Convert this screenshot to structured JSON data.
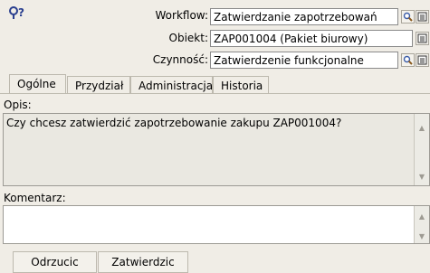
{
  "header": {
    "workflow_label": "Workflow:",
    "workflow_value": "Zatwierdzanie zapotrzebowań",
    "object_label": "Obiekt:",
    "object_value": "ZAP001004 (Pakiet biurowy)",
    "activity_label": "Czynność:",
    "activity_value": "Zatwierdzenie funkcjonalne"
  },
  "tabs": [
    {
      "label": "Ogólne"
    },
    {
      "label": "Przydział"
    },
    {
      "label": "Administracja"
    },
    {
      "label": "Historia"
    }
  ],
  "main": {
    "description_label": "Opis:",
    "description_text": "Czy chcesz zatwierdzić zapotrzebowanie zakupu ZAP001004?",
    "comment_label": "Komentarz:",
    "comment_value": ""
  },
  "buttons": {
    "reject": "Odrzucic",
    "approve": "Zatwierdzic"
  }
}
